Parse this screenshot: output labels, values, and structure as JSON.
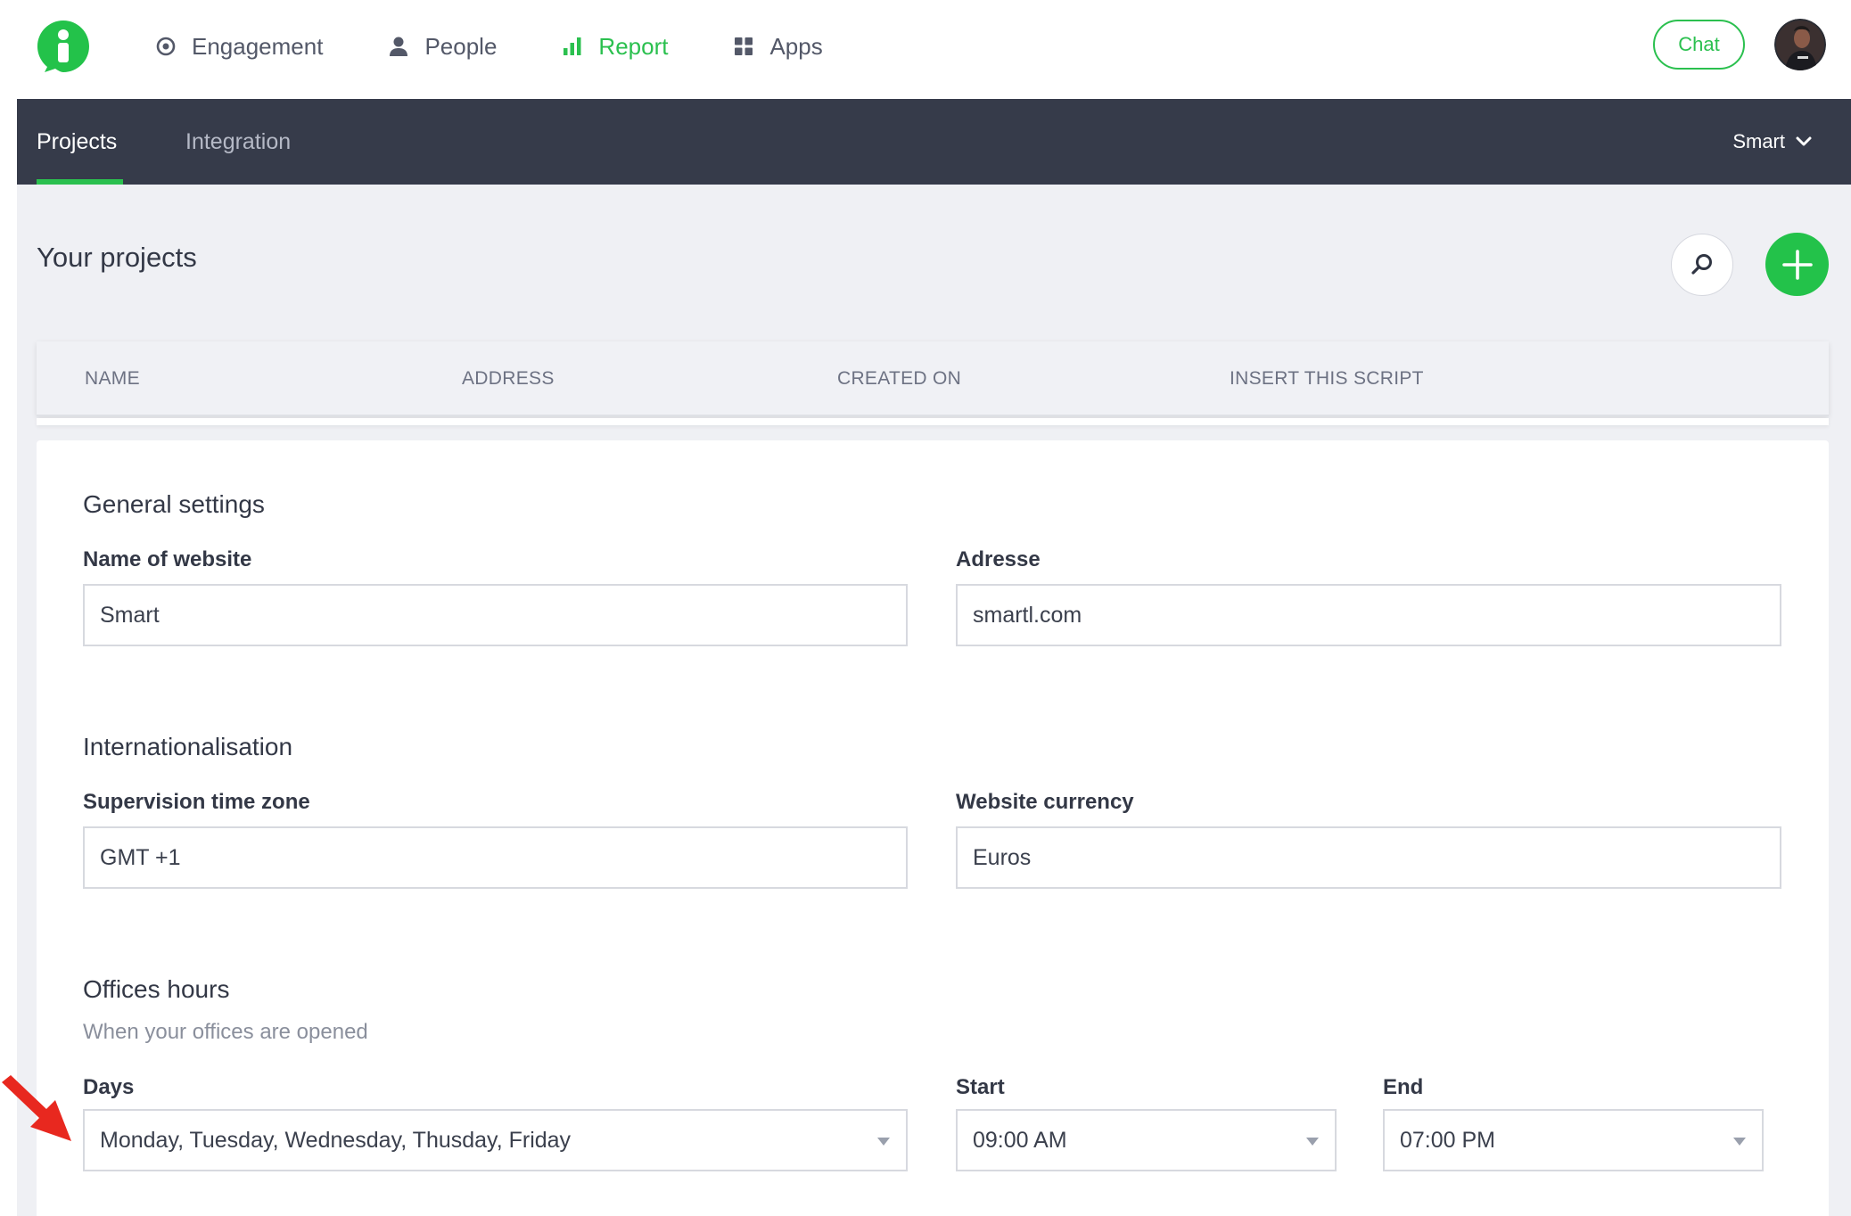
{
  "topnav": {
    "items": [
      {
        "label": "Engagement",
        "icon": "target-icon",
        "active": false
      },
      {
        "label": "People",
        "icon": "person-icon",
        "active": false
      },
      {
        "label": "Report",
        "icon": "bar-chart-icon",
        "active": true
      },
      {
        "label": "Apps",
        "icon": "grid-icon",
        "active": false
      }
    ],
    "chat_label": "Chat"
  },
  "subnav": {
    "tabs": [
      {
        "label": "Projects",
        "active": true
      },
      {
        "label": "Integration",
        "active": false
      }
    ],
    "workspace": "Smart"
  },
  "page": {
    "title": "Your projects"
  },
  "table": {
    "columns": [
      "NAME",
      "ADDRESS",
      "CREATED ON",
      "INSERT THIS SCRIPT"
    ]
  },
  "general": {
    "title": "General settings",
    "name_label": "Name of website",
    "name_value": "Smart",
    "address_label": "Adresse",
    "address_value": "smartl.com"
  },
  "intl": {
    "title": "Internationalisation",
    "timezone_label": "Supervision time zone",
    "timezone_value": "GMT +1",
    "currency_label": "Website currency",
    "currency_value": "Euros"
  },
  "hours": {
    "title": "Offices hours",
    "subtitle": "When your offices are opened",
    "days_label": "Days",
    "days_value": "Monday, Tuesday, Wednesday, Thusday, Friday",
    "start_label": "Start",
    "start_value": "09:00 AM",
    "end_label": "End",
    "end_value": "07:00 PM"
  },
  "colors": {
    "accent": "#2bc04f",
    "subbar": "#363b4a",
    "annotation_arrow": "#e8281f"
  }
}
